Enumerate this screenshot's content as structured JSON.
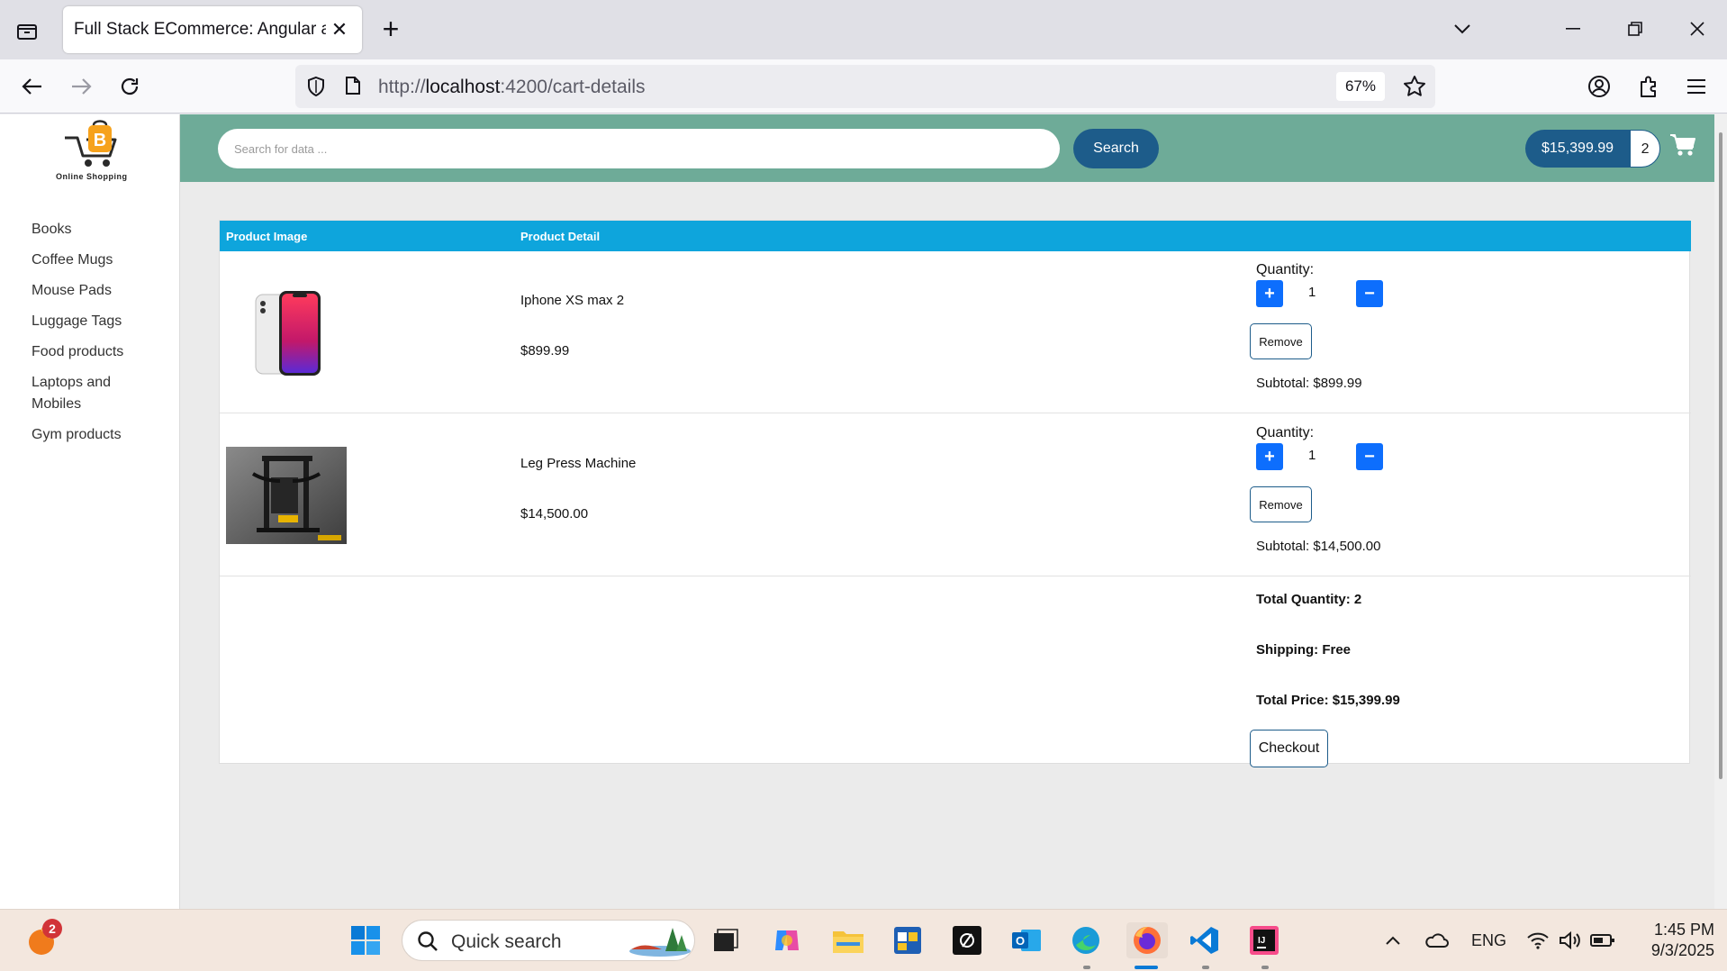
{
  "browser": {
    "tab_title": "Full Stack ECommerce: Angular and",
    "url_scheme": "http://",
    "url_host": "localhost",
    "url_path": ":4200/cart-details",
    "zoom": "67%"
  },
  "store": {
    "logo_text": "Online Shopping",
    "categories": [
      "Books",
      "Coffee Mugs",
      "Mouse Pads",
      "Luggage Tags",
      "Food products",
      "Laptops and Mobiles",
      "Gym products"
    ],
    "search": {
      "placeholder": "Search for data ...",
      "button": "Search"
    },
    "cart_status": {
      "total": "$15,399.99",
      "count": "2"
    }
  },
  "cart": {
    "headers": {
      "image": "Product Image",
      "detail": "Product Detail"
    },
    "quantity_label": "Quantity:",
    "remove_label": "Remove",
    "items": [
      {
        "name": "Iphone XS max 2",
        "price": "$899.99",
        "quantity": "1",
        "subtotal": "Subtotal: $899.99"
      },
      {
        "name": "Leg Press Machine",
        "price": "$14,500.00",
        "quantity": "1",
        "subtotal": "Subtotal: $14,500.00"
      }
    ],
    "summary": {
      "total_quantity": "Total Quantity: 2",
      "shipping": "Shipping: Free",
      "total_price": "Total Price: $15,399.99",
      "checkout": "Checkout"
    }
  },
  "taskbar": {
    "search_text": "Quick search",
    "notification_count": "2",
    "language": "ENG",
    "time": "1:45 PM",
    "date": "9/3/2025"
  },
  "colors": {
    "header_band": "#6eab98",
    "table_header": "#0ea5dc",
    "primary_dark": "#1d5c8a",
    "qty_button": "#0d6efd"
  }
}
